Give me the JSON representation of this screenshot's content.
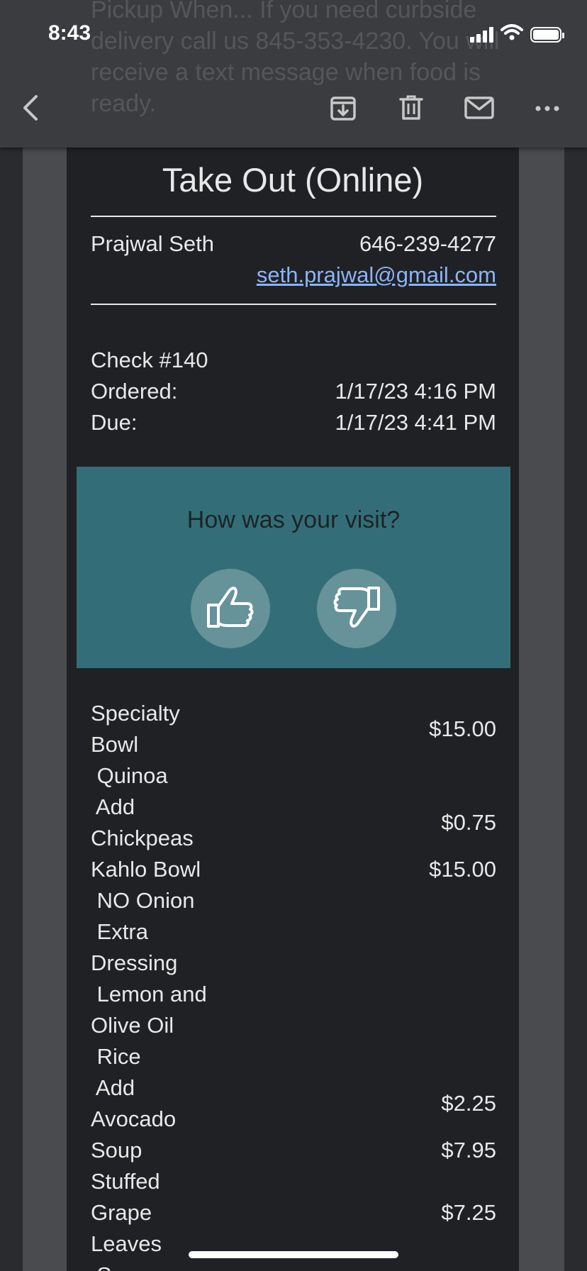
{
  "status": {
    "time": "8:43"
  },
  "email_bg_text": "Pickup When... If you need curbside delivery call us 845-353-4230. You will receive a text message when food is ready.",
  "toolbar": {
    "back_icon": "chevron-left-icon",
    "archive_icon": "archive-icon",
    "delete_icon": "trash-icon",
    "mail_icon": "envelope-icon",
    "more_icon": "more-horizontal-icon"
  },
  "receipt": {
    "title": "Take Out (Online)",
    "customer": {
      "name": "Prajwal Seth",
      "phone": "646-239-4277",
      "email": "seth.prajwal@gmail.com"
    },
    "check": "Check #140",
    "ordered_label": "Ordered:",
    "ordered_value": "1/17/23 4:16 PM",
    "due_label": "Due:",
    "due_value": "1/17/23 4:41 PM",
    "survey": {
      "question": "How was your visit?",
      "up_icon": "thumbs-up-icon",
      "down_icon": "thumbs-down-icon",
      "bg_color": "#336e78"
    },
    "items": [
      {
        "lines": [
          "Specialty",
          "Bowl"
        ],
        "price": "$15.00"
      },
      {
        "lines": [
          " Quinoa"
        ],
        "price": ""
      },
      {
        "lines": [
          " Add",
          "Chickpeas"
        ],
        "price": "$0.75"
      },
      {
        "lines": [
          "Kahlo Bowl"
        ],
        "price": "$15.00"
      },
      {
        "lines": [
          " NO Onion"
        ],
        "price": ""
      },
      {
        "lines": [
          " Extra",
          "Dressing"
        ],
        "price": ""
      },
      {
        "lines": [
          " Lemon and",
          "Olive Oil"
        ],
        "price": ""
      },
      {
        "lines": [
          " Rice"
        ],
        "price": ""
      },
      {
        "lines": [
          " Add",
          "Avocado"
        ],
        "price": "$2.25"
      },
      {
        "lines": [
          "Soup"
        ],
        "price": "$7.95"
      },
      {
        "lines": [
          "Stuffed",
          "Grape",
          "Leaves"
        ],
        "price": "$7.25"
      },
      {
        "lines": [
          " S"
        ],
        "price": ""
      }
    ]
  },
  "colors": {
    "link": "#8ab4f8",
    "background": "#202124",
    "toolbar": "#3b3c3f"
  }
}
